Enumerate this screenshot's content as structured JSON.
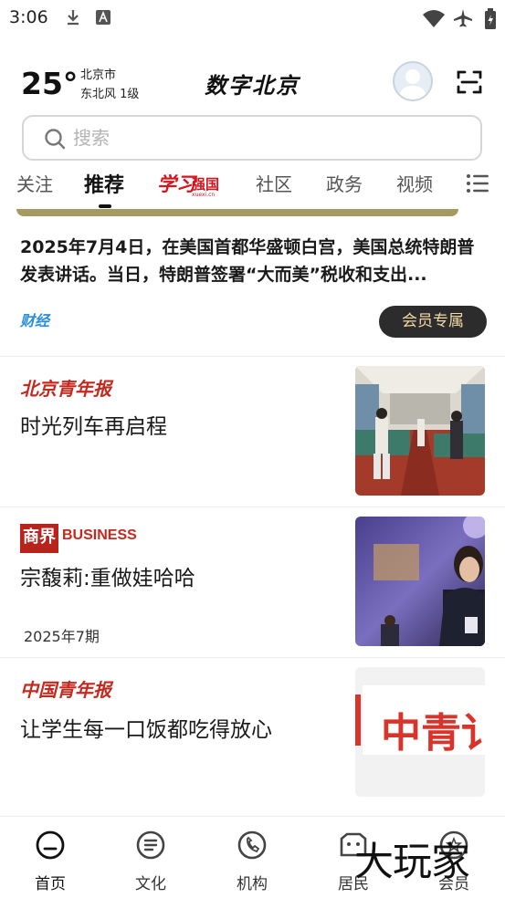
{
  "status_bar": {
    "time": "3:06",
    "icons": [
      "download-icon",
      "a-badge-icon",
      "wifi-icon",
      "airplane-icon",
      "battery-icon"
    ]
  },
  "header": {
    "temperature": "25°",
    "city": "北京市",
    "wind": "东北风  1级",
    "logo_text": "数字北京"
  },
  "search": {
    "placeholder": "搜索"
  },
  "tabs": {
    "items": [
      "关注",
      "推荐",
      "社区",
      "政务",
      "视频"
    ],
    "active": "推荐",
    "special_logo": {
      "main": "学习",
      "side": "强国",
      "domain": "xuexi.cn"
    }
  },
  "feed": {
    "item1": {
      "title": "2025年7月4日，在美国首都华盛顿白宫，美国总统特朗普发表讲话。当日，特朗普签署“大而美”税收和支出...",
      "source": "财经",
      "badge": "会员专属"
    },
    "item2": {
      "source": "北京青年报",
      "title": "时光列车再启程"
    },
    "item3": {
      "source_box": "商界",
      "source_text": "BUSINESS",
      "title": "宗馥莉:重做娃哈哈",
      "issue": "2025年7期"
    },
    "item4": {
      "source": "中国青年报",
      "title": "让学生每一口饭都吃得放心",
      "thumb_text": "中青讠"
    }
  },
  "bottom_nav": {
    "items": [
      {
        "label": "首页",
        "icon": "home-icon"
      },
      {
        "label": "文化",
        "icon": "culture-icon"
      },
      {
        "label": "机构",
        "icon": "phone-icon"
      },
      {
        "label": "居民",
        "icon": "resident-icon"
      },
      {
        "label": "会员",
        "icon": "member-icon"
      }
    ]
  },
  "watermark": "大玩家",
  "colors": {
    "accent_red": "#c4291f",
    "badge_bg": "#2c2c2c",
    "badge_text": "#f2d9a5",
    "source_blue": "#2a8fd8"
  }
}
